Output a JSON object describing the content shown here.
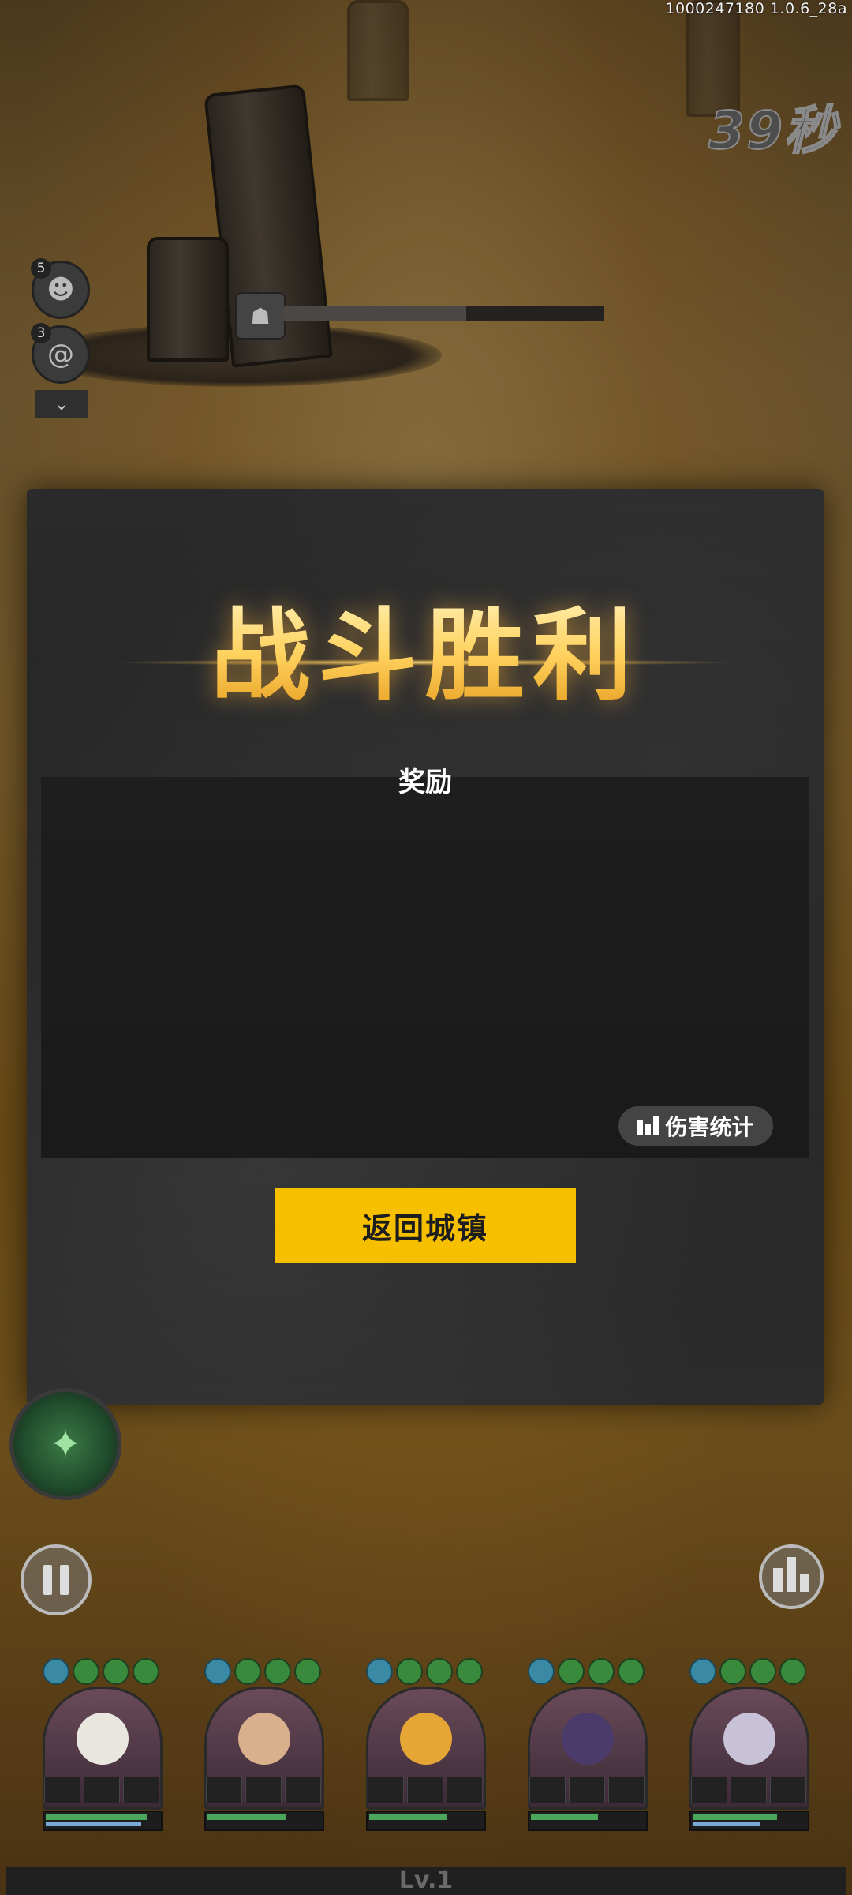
{
  "status": {
    "build": "1000247180  1.0.6_28a",
    "timer": "39秒"
  },
  "enemies": [
    {
      "count": "5",
      "icon": "moai-icon"
    },
    {
      "count": "3",
      "icon": "swirl-icon"
    }
  ],
  "boss_hp": {
    "fraction": 0.57
  },
  "result": {
    "title": "战斗胜利",
    "reward_label": "奖励",
    "damage_stats_label": "伤害统计",
    "return_button_label": "返回城镇"
  },
  "controls": {
    "pause_icon": "pause-icon",
    "stats_icon": "bar-chart-icon",
    "skill_icon": "skill-orb-icon"
  },
  "party": [
    {
      "portrait_color": "#e9e6df",
      "hp": 0.9,
      "mana": 0.85
    },
    {
      "portrait_color": "#d9b08c",
      "hp": 0.7,
      "mana": 0.0
    },
    {
      "portrait_color": "#e6a636",
      "hp": 0.7,
      "mana": 0.0
    },
    {
      "portrait_color": "#4b3b6a",
      "hp": 0.6,
      "mana": 0.0
    },
    {
      "portrait_color": "#c8c2d8",
      "hp": 0.75,
      "mana": 0.6
    }
  ],
  "footer": {
    "level": "Lv.1"
  },
  "colors": {
    "accent_yellow": "#f6c000",
    "title_gold": "#ffd25e",
    "panel": "#262626"
  }
}
